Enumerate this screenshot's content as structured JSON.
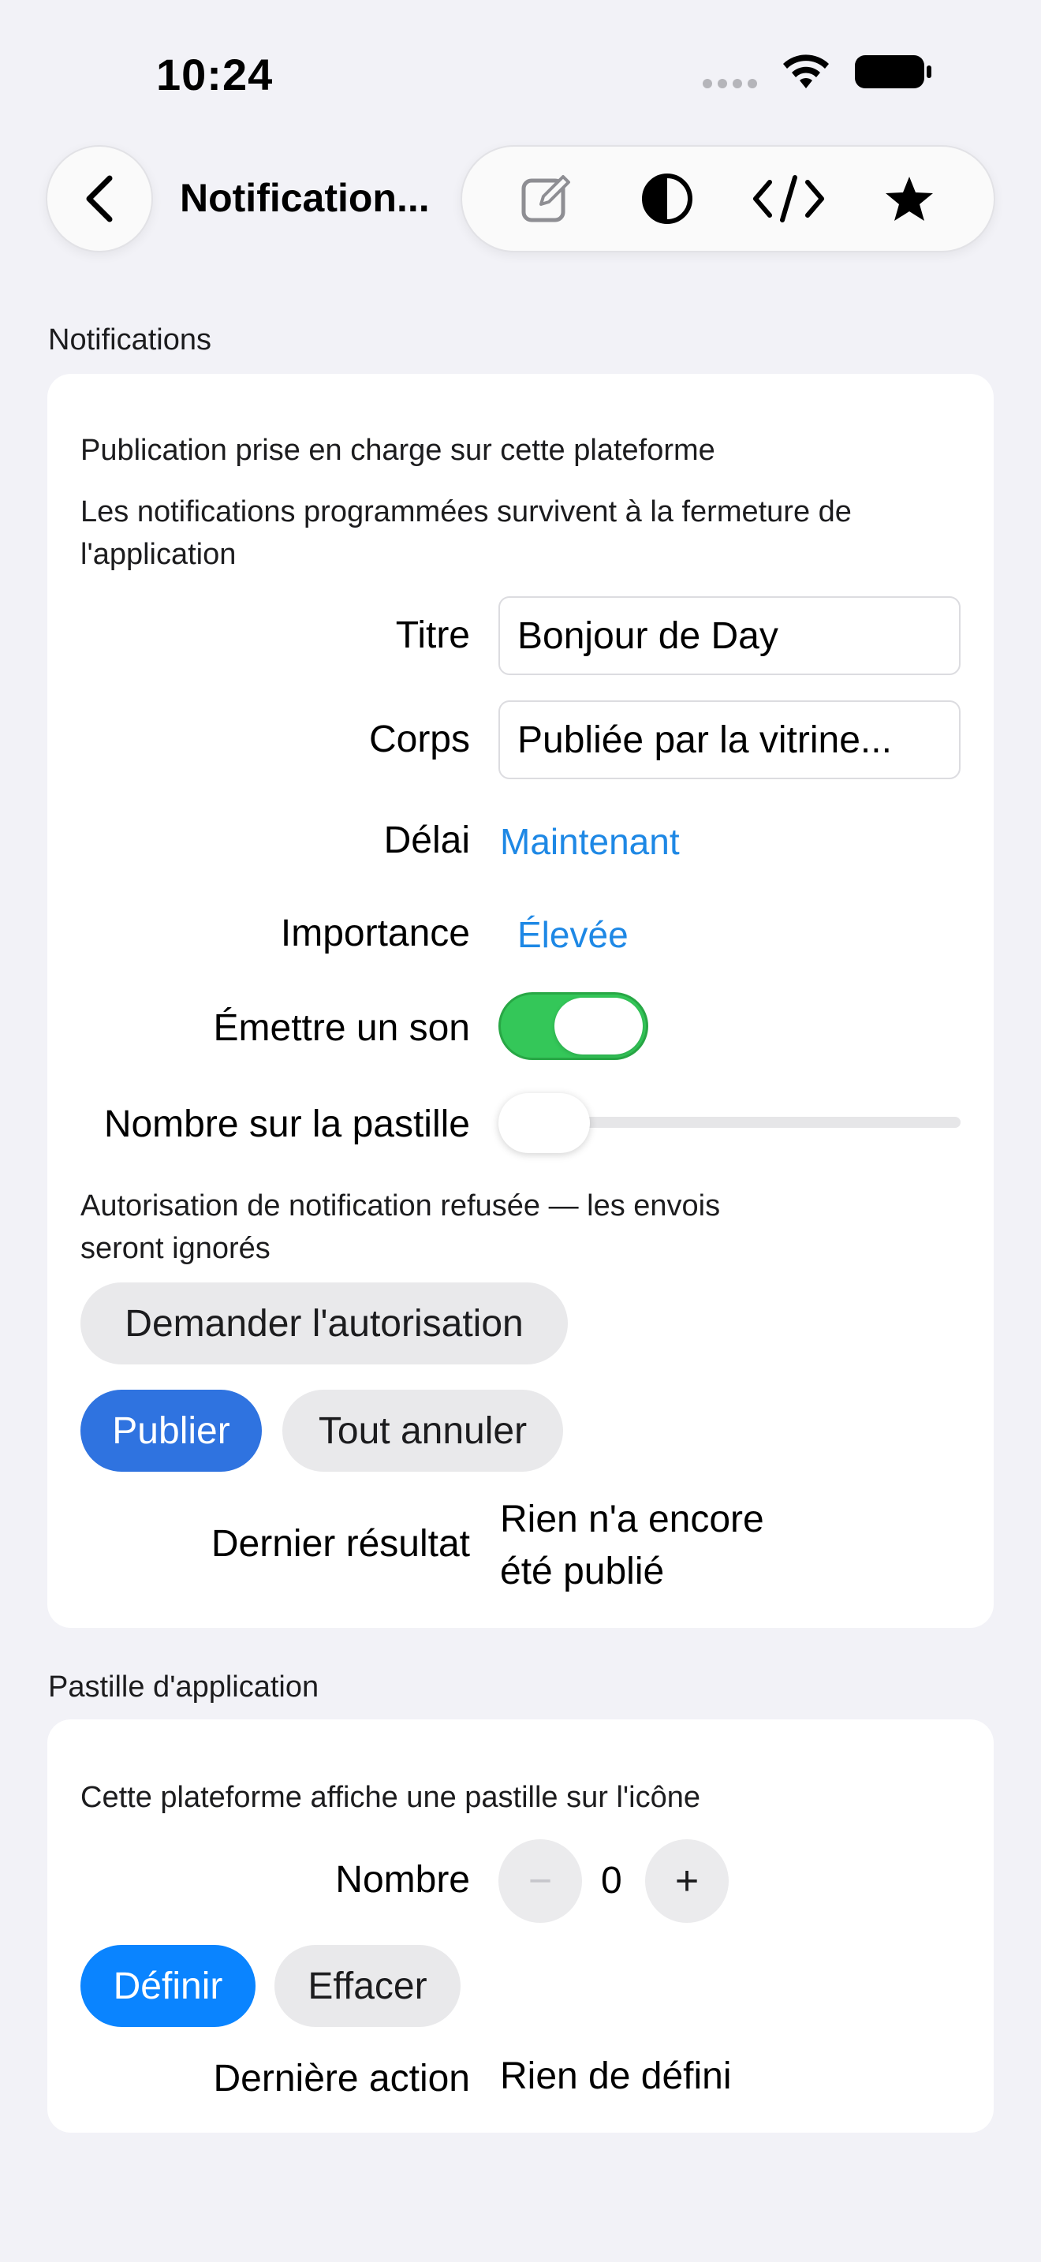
{
  "status_bar": {
    "time": "10:24"
  },
  "nav": {
    "title": "Notification..."
  },
  "notifications": {
    "section_title": "Notifications",
    "supported_text": "Publication prise en charge sur cette plateforme",
    "persist_text": "Les notifications programmées survivent à la fermeture de l'application",
    "title_label": "Titre",
    "title_value": "Bonjour de Day",
    "body_label": "Corps",
    "body_value": "Publiée par la vitrine...",
    "delay_label": "Délai",
    "delay_value": "Maintenant",
    "importance_label": "Importance",
    "importance_value": "Élevée",
    "sound_label": "Émettre un son",
    "sound_on": true,
    "badge_label": "Nombre sur la pastille",
    "badge_slider_fraction": 0,
    "denied_text": "Autorisation de notification refusée — les envois seront ignorés",
    "request_button": "Demander l'autorisation",
    "publish_button": "Publier",
    "cancel_all_button": "Tout annuler",
    "last_result_label": "Dernier résultat",
    "last_result_value": "Rien n'a encore été publié"
  },
  "app_badge": {
    "section_title": "Pastille d'application",
    "platform_text": "Cette plateforme affiche une pastille sur l'icône",
    "count_label": "Nombre",
    "count_value": "0",
    "minus_label": "−",
    "plus_label": "+",
    "set_button": "Définir",
    "clear_button": "Effacer",
    "last_action_label": "Dernière action",
    "last_action_value": "Rien de défini"
  },
  "colors": {
    "accent_blue": "#2f73e0",
    "link_blue": "#1e88e5",
    "toggle_green": "#34c759"
  }
}
